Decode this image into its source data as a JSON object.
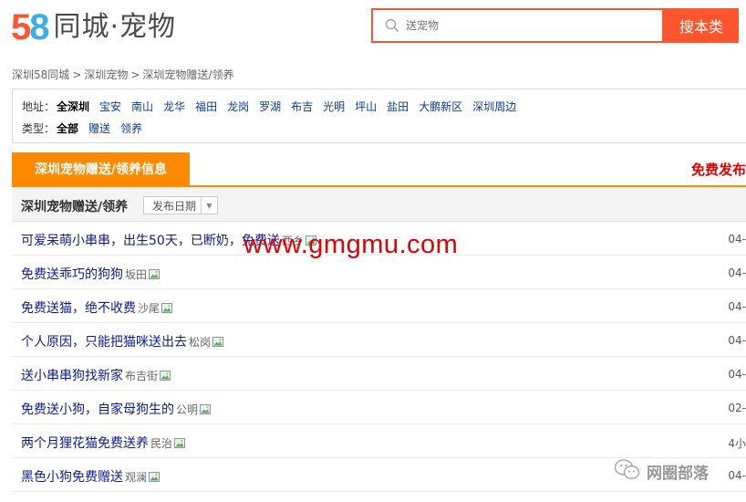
{
  "logo": {
    "digit_5": "5",
    "digit_8": "8",
    "text": "同城·宠物"
  },
  "search": {
    "placeholder": "送宠物",
    "button_label": "搜本类"
  },
  "breadcrumb": [
    "深圳58同城",
    "深圳宠物",
    "深圳宠物赠送/领养"
  ],
  "breadcrumb_sep": ">",
  "filters": {
    "area": {
      "label": "地址：",
      "options": [
        "全深圳",
        "宝安",
        "南山",
        "龙华",
        "福田",
        "龙岗",
        "罗湖",
        "布吉",
        "光明",
        "坪山",
        "盐田",
        "大鹏新区",
        "深圳周边"
      ],
      "active": "全深圳"
    },
    "type": {
      "label": "类型：",
      "options": [
        "全部",
        "赠送",
        "领养"
      ],
      "active": "全部"
    }
  },
  "tab": {
    "active_label": "深圳宠物赠送/领养信息",
    "post_free": "免费发布"
  },
  "list_header": {
    "title": "深圳宠物赠送/领养",
    "sort_label": "发布日期"
  },
  "listings": [
    {
      "title": "可爱呆萌小串串，出生50天，已断奶，免费送",
      "location": "西乡",
      "date": "04-"
    },
    {
      "title": "免费送乖巧的狗狗",
      "location": "坂田",
      "date": "04-"
    },
    {
      "title": "免费送猫，绝不收费",
      "location": "沙尾",
      "date": "04-"
    },
    {
      "title": "个人原因，只能把猫咪送出去",
      "location": "松岗",
      "date": "04-"
    },
    {
      "title": "送小串串狗找新家",
      "location": "布吉街",
      "date": "04-"
    },
    {
      "title": "免费送小狗，自家母狗生的",
      "location": "公明",
      "date": "02-"
    },
    {
      "title": "两个月狸花猫免费送养",
      "location": "民治",
      "date": "4小"
    },
    {
      "title": "黑色小狗免费赠送",
      "location": "观澜",
      "date": "04-"
    }
  ],
  "watermark": "www.gmgmu.com",
  "wechat_label": "网圈部落",
  "colors": {
    "brand_orange": "#ff552e",
    "tab_orange": "#ff8a00",
    "link_blue": "#0b1d93",
    "post_red": "#e10000",
    "logo_blue": "#3aafe7"
  },
  "icons": [
    "search-icon",
    "image-icon",
    "dropdown-arrow-icon",
    "wechat-icon"
  ]
}
